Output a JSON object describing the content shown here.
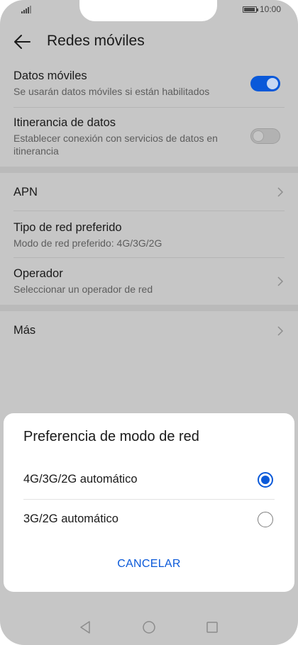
{
  "status_bar": {
    "time": "10:00",
    "battery_level": 0.85
  },
  "header": {
    "title": "Redes móviles"
  },
  "settings": {
    "datos_moviles": {
      "label": "Datos móviles",
      "sub": "Se usarán datos móviles si están habilitados",
      "enabled": true
    },
    "itinerancia": {
      "label": "Itinerancia de datos",
      "sub": "Establecer conexión con servicios de datos en itinerancia",
      "enabled": false
    },
    "apn": {
      "label": "APN"
    },
    "tipo_red": {
      "label": "Tipo de red preferido",
      "sub": "Modo de red preferido: 4G/3G/2G"
    },
    "operador": {
      "label": "Operador",
      "sub": "Seleccionar un operador de red"
    },
    "mas": {
      "label": "Más"
    }
  },
  "dialog": {
    "title": "Preferencia de modo de red",
    "options": [
      {
        "label": "4G/3G/2G automático",
        "selected": true
      },
      {
        "label": "3G/2G automático",
        "selected": false
      }
    ],
    "cancel_label": "CANCELAR"
  },
  "colors": {
    "accent": "#0a59d9",
    "dim_background": "#c6c6c6"
  },
  "nav_bar": {
    "icons": [
      "back-triangle-icon",
      "home-circle-icon",
      "recents-square-icon"
    ]
  }
}
